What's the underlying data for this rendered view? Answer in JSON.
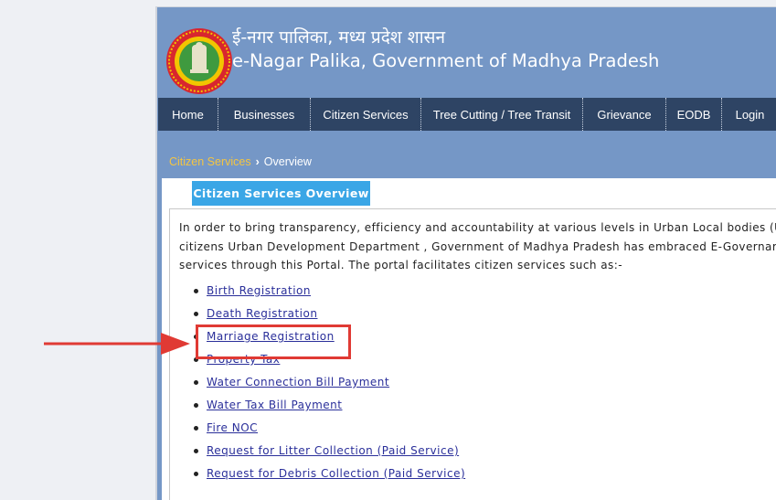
{
  "header": {
    "title_hindi": "ई-नगर पालिका, मध्य प्रदेश शासन",
    "title_english": "e-Nagar Palika, Government of Madhya Pradesh",
    "logo_icon": "mp-government-emblem-icon"
  },
  "nav": {
    "items": [
      {
        "label": "Home"
      },
      {
        "label": "Businesses"
      },
      {
        "label": "Citizen Services"
      },
      {
        "label": "Tree Cutting / Tree Transit"
      },
      {
        "label": "Grievance"
      },
      {
        "label": "EODB"
      },
      {
        "label": "Login"
      }
    ]
  },
  "breadcrumb": {
    "parent": "Citizen Services",
    "separator": "›",
    "current": "Overview"
  },
  "tab": {
    "label": "Citizen Services Overview"
  },
  "intro": {
    "lines": [
      "In order to bring transparency, efficiency and accountability at various levels in Urban Local bodies (UL",
      "citizens Urban Development Department , Government of Madhya Pradesh has embraced E-Governar",
      "services through this Portal. The portal facilitates citizen services such as:-"
    ]
  },
  "services": [
    {
      "label": "Birth Registration"
    },
    {
      "label": "Death Registration"
    },
    {
      "label": "Marriage Registration"
    },
    {
      "label": "Property Tax"
    },
    {
      "label": "Water Connection Bill Payment"
    },
    {
      "label": "Water Tax Bill Payment"
    },
    {
      "label": "Fire NOC"
    },
    {
      "label": "Request for Litter Collection (Paid Service)"
    },
    {
      "label": "Request for Debris Collection (Paid Service)"
    }
  ],
  "colors": {
    "header_bg": "#7597c6",
    "nav_bg": "#2e4464",
    "tab_bg": "#3aa6e6",
    "breadcrumb_link": "#f4c542",
    "link": "#2a2f9a",
    "annotation": "#e03a34"
  }
}
